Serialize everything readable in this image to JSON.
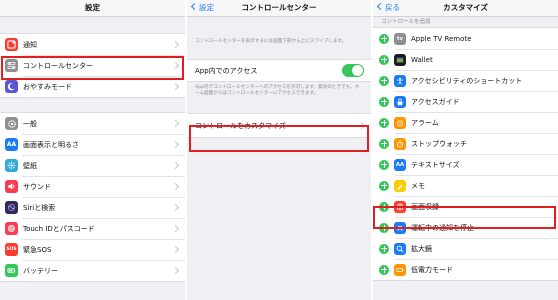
{
  "settings": {
    "title": "設定",
    "group1": [
      {
        "label": "通知",
        "icon": "notification-icon",
        "color": "#fb3b30"
      },
      {
        "label": "コントロールセンター",
        "icon": "control-center-icon",
        "color": "#8e8e93"
      },
      {
        "label": "おやすみモード",
        "icon": "moon-icon",
        "color": "#5856d6"
      }
    ],
    "group2": [
      {
        "label": "一般",
        "icon": "gear-icon",
        "color": "#8e8e93"
      },
      {
        "label": "画面表示と明るさ",
        "icon": "display-icon",
        "color": "#1a7cf5",
        "glyph": "AA"
      },
      {
        "label": "壁紙",
        "icon": "wallpaper-icon",
        "color": "#34aadc"
      },
      {
        "label": "サウンド",
        "icon": "sound-icon",
        "color": "#fb3b50"
      },
      {
        "label": "Siriと検索",
        "icon": "siri-icon",
        "color": "#2c2c54"
      },
      {
        "label": "Touch IDとパスコード",
        "icon": "fingerprint-icon",
        "color": "#fb3b50"
      },
      {
        "label": "緊急SOS",
        "icon": "sos-icon",
        "color": "#fb3b30",
        "glyph": "SOS"
      },
      {
        "label": "バッテリー",
        "icon": "battery-icon",
        "color": "#35c759"
      }
    ]
  },
  "control_center": {
    "back": "設定",
    "title": "コントロールセンター",
    "intro": "コントロールセンターを表示するには画面下部から上にスワイプします。",
    "toggle_label": "App内でのアクセス",
    "toggle_on": true,
    "toggle_desc": "App内でコントロールセンターへのアクセスを許可します。無効のときでも、ホーム画面からはコントロールセンターにアクセスできます。",
    "customize_label": "コントロールをカスタマイズ"
  },
  "customize": {
    "back": "戻る",
    "title": "カスタマイズ",
    "section": "コントロールを追加",
    "items": [
      {
        "label": "Apple TV Remote",
        "icon": "apple-tv-icon",
        "color": "#8e8e93",
        "glyph": "tv"
      },
      {
        "label": "Wallet",
        "icon": "wallet-icon",
        "color": "#1c1c1e"
      },
      {
        "label": "アクセシビリティのショートカット",
        "icon": "accessibility-icon",
        "color": "#1a7cf5"
      },
      {
        "label": "アクセスガイド",
        "icon": "lock-icon",
        "color": "#1a7cf5"
      },
      {
        "label": "アラーム",
        "icon": "alarm-icon",
        "color": "#ff9500"
      },
      {
        "label": "ストップウォッチ",
        "icon": "stopwatch-icon",
        "color": "#ff9500"
      },
      {
        "label": "テキストサイズ",
        "icon": "text-size-icon",
        "color": "#1a7cf5",
        "glyph": "AA"
      },
      {
        "label": "メモ",
        "icon": "notes-icon",
        "color": "#ffcc00"
      },
      {
        "label": "画面収録",
        "icon": "screen-record-icon",
        "color": "#fb3b30"
      },
      {
        "label": "運転中の通知を停止",
        "icon": "car-icon",
        "color": "#1a7cf5"
      },
      {
        "label": "拡大鏡",
        "icon": "magnifier-icon",
        "color": "#1a7cf5"
      },
      {
        "label": "低電力モード",
        "icon": "low-power-icon",
        "color": "#ff9500"
      }
    ]
  },
  "highlight_color": "#e02020"
}
